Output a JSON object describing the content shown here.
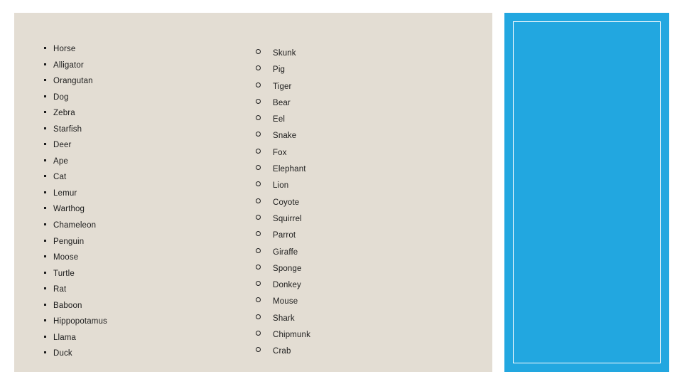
{
  "slide": {
    "background_color": "#ffffff",
    "content_panel": {
      "background_color": "#e3ddd3"
    },
    "accent_panel": {
      "background_color": "#22a7e0",
      "border_color": "#ffffff"
    }
  },
  "lists": {
    "primary": {
      "bullet_glyph": "square-bullet",
      "items": [
        {
          "label": "Horse"
        },
        {
          "label": "Alligator"
        },
        {
          "label": "Orangutan"
        },
        {
          "label": "Dog"
        },
        {
          "label": "Zebra"
        },
        {
          "label": "Starfish"
        },
        {
          "label": "Deer"
        },
        {
          "label": "Ape"
        },
        {
          "label": "Cat"
        },
        {
          "label": "Lemur"
        },
        {
          "label": "Warthog"
        },
        {
          "label": "Chameleon"
        },
        {
          "label": "Penguin"
        },
        {
          "label": "Moose"
        },
        {
          "label": "Turtle"
        },
        {
          "label": "Rat"
        },
        {
          "label": "Baboon"
        },
        {
          "label": "Hippopotamus"
        },
        {
          "label": "Llama"
        },
        {
          "label": "Duck"
        }
      ]
    },
    "secondary": {
      "bullet_glyph": "circle-bullet",
      "items": [
        {
          "label": "Skunk"
        },
        {
          "label": "Pig"
        },
        {
          "label": "Tiger"
        },
        {
          "label": "Bear"
        },
        {
          "label": "Eel"
        },
        {
          "label": "Snake"
        },
        {
          "label": "Fox"
        },
        {
          "label": "Elephant"
        },
        {
          "label": "Lion"
        },
        {
          "label": "Coyote"
        },
        {
          "label": "Squirrel"
        },
        {
          "label": "Parrot"
        },
        {
          "label": "Giraffe"
        },
        {
          "label": "Sponge"
        },
        {
          "label": "Donkey"
        },
        {
          "label": "Mouse"
        },
        {
          "label": "Shark"
        },
        {
          "label": "Chipmunk"
        },
        {
          "label": "Crab"
        }
      ]
    }
  }
}
